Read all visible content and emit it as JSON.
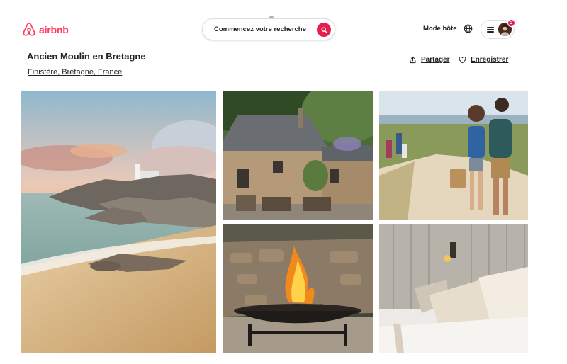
{
  "header": {
    "logo_text": "airbnb",
    "search_label": "Commencez votre recherche",
    "host_label": "Mode hôte",
    "notification_count": "2",
    "brand_color": "#ff385c",
    "search_button_color": "#e61e4d"
  },
  "listing": {
    "title": "Ancien Moulin en Bretagne",
    "location": "Finistère, Bretagne, France",
    "share_label": "Partager",
    "save_label": "Enregistrer"
  },
  "gallery": {
    "photos": [
      {
        "name": "coast-lighthouse-photo"
      },
      {
        "name": "stone-house-terrace-photo"
      },
      {
        "name": "beach-path-walk-photo"
      },
      {
        "name": "fire-pit-photo"
      },
      {
        "name": "bedroom-pillows-photo"
      }
    ]
  },
  "icons": [
    "airbnb-logo-icon",
    "search-icon",
    "globe-icon",
    "menu-icon",
    "share-icon",
    "heart-icon"
  ]
}
